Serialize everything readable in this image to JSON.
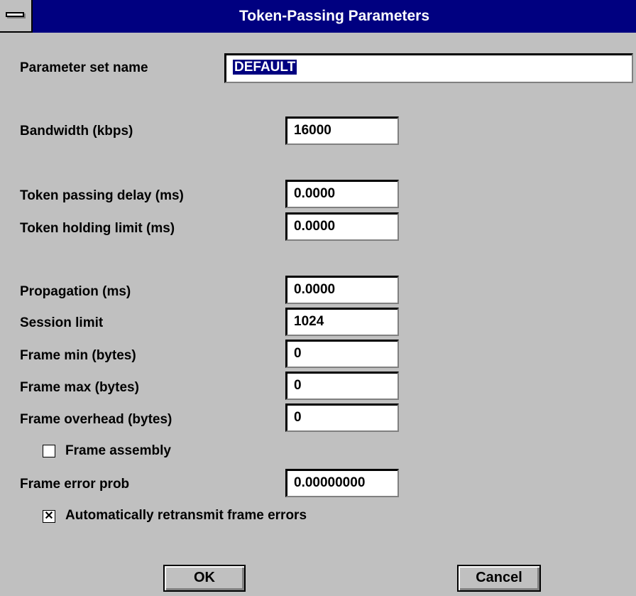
{
  "window": {
    "title": "Token-Passing Parameters"
  },
  "fields": {
    "param_set_name": {
      "label": "Parameter set name",
      "value": "DEFAULT"
    },
    "bandwidth": {
      "label": "Bandwidth (kbps)",
      "value": "16000"
    },
    "token_passing_delay": {
      "label": "Token passing delay (ms)",
      "value": "0.0000"
    },
    "token_holding_limit": {
      "label": "Token holding limit (ms)",
      "value": "0.0000"
    },
    "propagation": {
      "label": "Propagation (ms)",
      "value": "0.0000"
    },
    "session_limit": {
      "label": "Session limit",
      "value": "1024"
    },
    "frame_min": {
      "label": "Frame min (bytes)",
      "value": "0"
    },
    "frame_max": {
      "label": "Frame max (bytes)",
      "value": "0"
    },
    "frame_overhead": {
      "label": "Frame overhead (bytes)",
      "value": "0"
    },
    "frame_error_prob": {
      "label": "Frame error prob",
      "value": "0.00000000"
    }
  },
  "checkboxes": {
    "frame_assembly": {
      "label": "Frame assembly",
      "checked": false,
      "mark": ""
    },
    "auto_retransmit": {
      "label": "Automatically retransmit frame errors",
      "checked": true,
      "mark": "✕"
    }
  },
  "buttons": {
    "ok": "OK",
    "cancel": "Cancel"
  }
}
